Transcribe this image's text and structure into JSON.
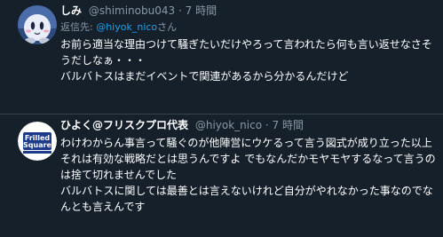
{
  "tweets": [
    {
      "name": "しみ",
      "handle": "@shiminobu043",
      "separator": "·",
      "time": "7 時間",
      "reply_prefix": "返信先: ",
      "reply_mention": "@hiyok_nico",
      "reply_suffix": "さん",
      "lines": [
        "お前ら適当な理由つけて騒ぎたいだけやろって言われたら何も言い返せなさそ",
        "うだしなぁ・・・",
        "バルバトスはまだイベントで関連があるから分かるんだけど"
      ]
    },
    {
      "name": "ひよく@フリスクプロ代表",
      "handle": "@hiyok_nico",
      "separator": "·",
      "time": "7 時間",
      "avatar_text_top": "Frilled",
      "avatar_text_bottom": "Square",
      "lines": [
        "わけわからん事言って騒ぐのが他陣営にウケるって言う図式が成り立った以上",
        "それは有効な戦略だとは思うんですよ でもなんだかモヤモヤするなって言うの",
        "は捨て切れませんでした",
        "バルバトスに関しては最善とは言えないけれど自分がやれなかった事なのでな",
        "んとも言えんです"
      ]
    }
  ],
  "colors": {
    "background": "#15202b",
    "link": "#1da1f2",
    "secondary_text": "#8899a6",
    "divider": "#38444d"
  }
}
